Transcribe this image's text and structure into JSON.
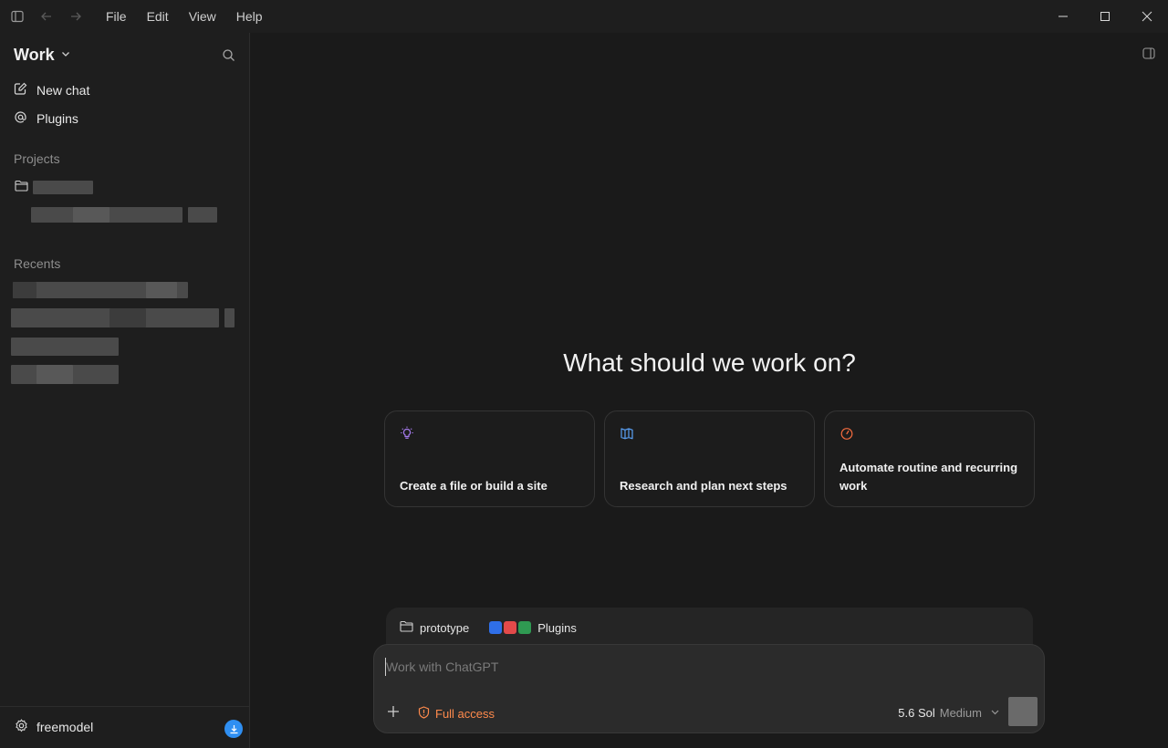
{
  "menu": [
    "File",
    "Edit",
    "View",
    "Help"
  ],
  "sidebar": {
    "workspace": "Work",
    "nav": [
      {
        "label": "New chat",
        "icon": "compose-icon"
      },
      {
        "label": "Plugins",
        "icon": "at-icon"
      }
    ],
    "projects_label": "Projects",
    "recents_label": "Recents",
    "user": "freemodel"
  },
  "main": {
    "headline": "What should we work on?",
    "cards": [
      {
        "label": "Create a file or build a site",
        "icon": "lightbulb-icon",
        "color": "#a87cf0"
      },
      {
        "label": "Research and plan next steps",
        "icon": "book-icon",
        "color": "#5aa0f5"
      },
      {
        "label": "Automate routine and recurring work",
        "icon": "stopwatch-icon",
        "color": "#f06a3e"
      }
    ]
  },
  "composer": {
    "project": "prototype",
    "plugins_label": "Plugins",
    "placeholder": "Work with ChatGPT",
    "access": "Full access",
    "model_name": "5.6 Sol",
    "model_effort": "Medium"
  },
  "colors": {
    "accent_orange": "#ff8a4c",
    "download_badge": "#2f8ff2"
  }
}
